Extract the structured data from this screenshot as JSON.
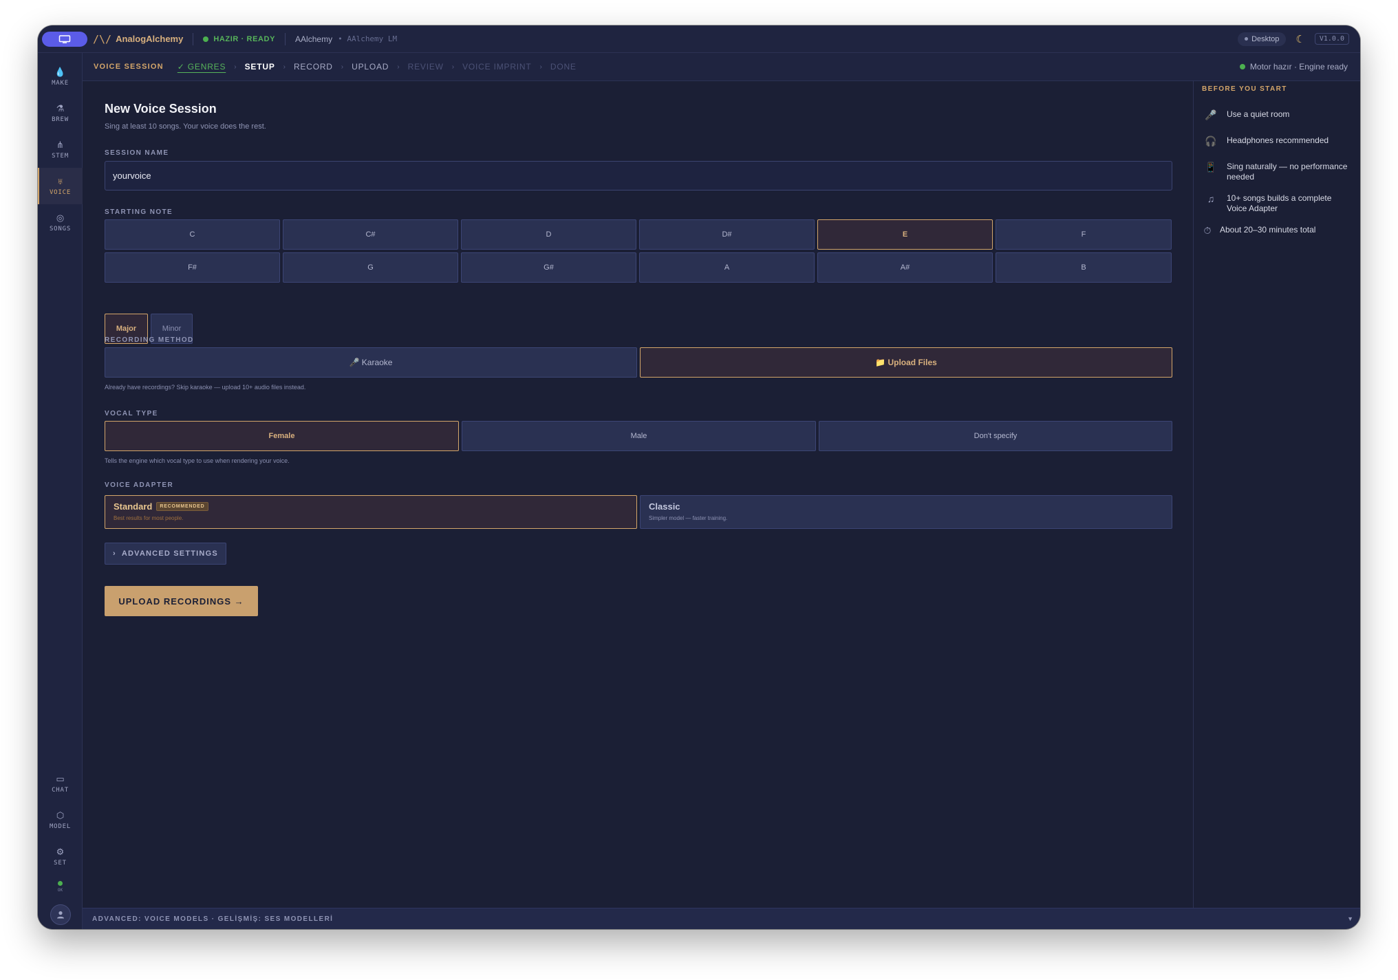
{
  "topbar": {
    "brand": "AnalogAlchemy",
    "logo_glyph": "/\\/",
    "status": "HAZIR · READY",
    "project": "AAlchemy",
    "project_sub": "• AAlchemy LM",
    "desktop": "Desktop",
    "moon_icon": "☾",
    "version": "V1.0.0"
  },
  "sidebar": {
    "items": [
      {
        "label": "MAKE",
        "icon": "💧",
        "icon_name": "droplet-icon"
      },
      {
        "label": "BREW",
        "icon": "⚗",
        "icon_name": "flask-icon"
      },
      {
        "label": "STEM",
        "icon": "⋔",
        "icon_name": "fork-icon"
      },
      {
        "label": "VOICE",
        "icon": "♅",
        "icon_name": "mic-icon"
      },
      {
        "label": "SONGS",
        "icon": "◎",
        "icon_name": "disc-icon"
      }
    ],
    "bottom_items": [
      {
        "label": "CHAT",
        "icon": "▭",
        "icon_name": "chat-icon"
      },
      {
        "label": "MODEL",
        "icon": "⬡",
        "icon_name": "cube-icon"
      },
      {
        "label": "SET",
        "icon": "⚙",
        "icon_name": "gear-icon"
      }
    ],
    "ok_label": "OK"
  },
  "breadcrumb": {
    "title": "VOICE SESSION",
    "steps": [
      {
        "label": "✓ GENRES",
        "state": "done"
      },
      {
        "label": "SETUP",
        "state": "current"
      },
      {
        "label": "RECORD",
        "state": "pending"
      },
      {
        "label": "UPLOAD",
        "state": "pending"
      },
      {
        "label": "REVIEW",
        "state": "future"
      },
      {
        "label": "VOICE IMPRINT",
        "state": "future"
      },
      {
        "label": "DONE",
        "state": "future"
      }
    ],
    "engine_status": "Motor hazır · Engine ready"
  },
  "main": {
    "title": "New Voice Session",
    "subtitle": "Sing at least 10 songs. Your voice does the rest.",
    "session_name_label": "SESSION NAME",
    "session_name_value": "yourvoice",
    "starting_note_label": "STARTING NOTE",
    "notes": [
      "C",
      "C#",
      "D",
      "D#",
      "E",
      "F",
      "F#",
      "G",
      "G#",
      "A",
      "A#",
      "B"
    ],
    "selected_note": "E",
    "modes": [
      "Major",
      "Minor"
    ],
    "selected_mode": "Major",
    "recording_method_label": "RECORDING METHOD",
    "recording_methods": [
      "🎤 Karaoke",
      "📁 Upload Files"
    ],
    "selected_method": "📁 Upload Files",
    "recording_help": "Already have recordings? Skip karaoke — upload 10+ audio files instead.",
    "vocal_type_label": "VOCAL TYPE",
    "vocal_types": [
      "Female",
      "Male",
      "Don't specify"
    ],
    "selected_vocal": "Female",
    "vocal_help": "Tells the engine which vocal type to use when rendering your voice.",
    "voice_adapter_label": "VOICE ADAPTER",
    "adapters": [
      {
        "name": "Standard",
        "badge": "RECOMMENDED",
        "desc": "Best results for most people."
      },
      {
        "name": "Classic",
        "badge": "",
        "desc": "Simpler model — faster training."
      }
    ],
    "selected_adapter": "Standard",
    "advanced_label": "ADVANCED SETTINGS",
    "advanced_chevron": "›",
    "cta_label": "UPLOAD RECORDINGS →"
  },
  "right_panel": {
    "title": "BEFORE YOU START",
    "tips": [
      {
        "icon": "🎤",
        "icon_name": "mic-icon",
        "text": "Use a quiet room"
      },
      {
        "icon": "🎧",
        "icon_name": "headphones-icon",
        "text": "Headphones recommended"
      },
      {
        "icon": "📱",
        "icon_name": "phone-icon",
        "text": "Sing naturally — no performance needed"
      },
      {
        "icon": "♫",
        "icon_name": "music-note-icon",
        "text": "10+ songs builds a complete Voice Adapter"
      },
      {
        "icon": "⏱",
        "icon_name": "timer-icon",
        "text": "About 20–30 minutes total"
      }
    ]
  },
  "bottombar": {
    "label": "ADVANCED: VOICE MODELS · GELİŞMİŞ: SES MODELLERİ",
    "toggle": "▼"
  },
  "colors": {
    "accent": "#d4a66a",
    "ready_green": "#4cb050",
    "background": "#1b1f35",
    "tile": "#2a3152",
    "primary_pill": "#5b5ce8"
  }
}
